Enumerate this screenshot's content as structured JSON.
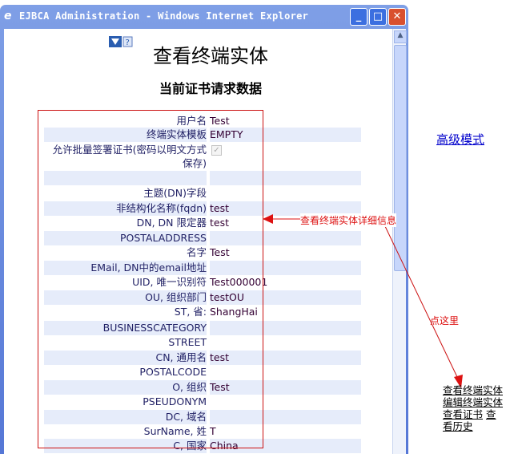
{
  "window": {
    "title": "EJBCA Administration - Windows Internet Explorer",
    "minimize": "_",
    "maximize": "□",
    "close": "✕"
  },
  "page": {
    "title": "查看终端实体",
    "subtitle": "当前证书请求数据"
  },
  "rows": [
    {
      "label": "用户名",
      "value": "Test"
    },
    {
      "label": "终端实体模板",
      "value": "EMPTY"
    },
    {
      "label": "允许批量签署证书(密码以明文方式保存)",
      "value": "",
      "checkbox": true
    },
    {
      "label": "",
      "value": ""
    },
    {
      "label": "主题(DN)字段",
      "value": ""
    },
    {
      "label": "非结构化名称(fqdn)",
      "value": "test"
    },
    {
      "label": "DN, DN 限定器",
      "value": "test"
    },
    {
      "label": "POSTALADDRESS",
      "value": ""
    },
    {
      "label": "名字",
      "value": "Test"
    },
    {
      "label": "EMail, DN中的email地址",
      "value": ""
    },
    {
      "label": "UID, 唯一识别符",
      "value": "Test000001"
    },
    {
      "label": "OU, 组织部门",
      "value": "testOU"
    },
    {
      "label": "ST, 省:",
      "value": "ShangHai"
    },
    {
      "label": "BUSINESSCATEGORY",
      "value": ""
    },
    {
      "label": "STREET",
      "value": ""
    },
    {
      "label": "CN, 通用名",
      "value": "test"
    },
    {
      "label": "POSTALCODE",
      "value": ""
    },
    {
      "label": "O, 组织",
      "value": "Test"
    },
    {
      "label": "PSEUDONYM",
      "value": ""
    },
    {
      "label": "DC, 域名",
      "value": ""
    },
    {
      "label": "SurName, 姓",
      "value": "T"
    },
    {
      "label": "C, 国家",
      "value": "China"
    }
  ],
  "annotations": {
    "detail": "查看终端实体详细信息",
    "click_here": "点这里"
  },
  "side": {
    "advanced_mode": "高级模式",
    "links": [
      "查看终端实体",
      "编辑终端实体",
      "查看证书",
      "查看历史"
    ]
  },
  "colors": {
    "annotation": "#dd1111",
    "row_shade": "#e6ecfa"
  }
}
